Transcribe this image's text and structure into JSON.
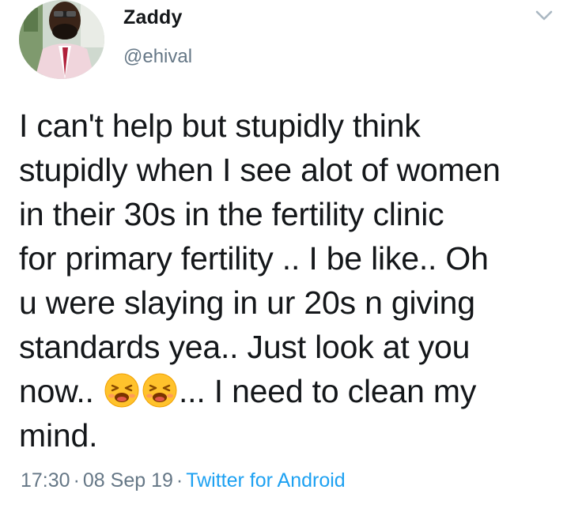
{
  "user": {
    "display_name": "Zaddy",
    "handle": "@ehival",
    "avatar_icon": "profile-photo"
  },
  "menu": {
    "icon": "chevron-down-icon"
  },
  "tweet": {
    "line1": "I can't help but stupidly think",
    "line2": "stupidly when I see alot of women",
    "line3": "in their 30s in the fertility clinic",
    "line4": "for primary fertility .. I be like.. Oh",
    "line5": "u were slaying in ur 20s n giving",
    "line6": "standards yea.. Just look at you",
    "line7_start": "now.. ",
    "emoji": "tired-face-emoji",
    "line7_end": "... I need to clean my",
    "line8": "mind."
  },
  "meta": {
    "time": "17:30",
    "separator": "·",
    "date": "08 Sep 19",
    "source": "Twitter for Android"
  },
  "colors": {
    "text": "#14171a",
    "secondary": "#657786",
    "link": "#1da1f2"
  }
}
